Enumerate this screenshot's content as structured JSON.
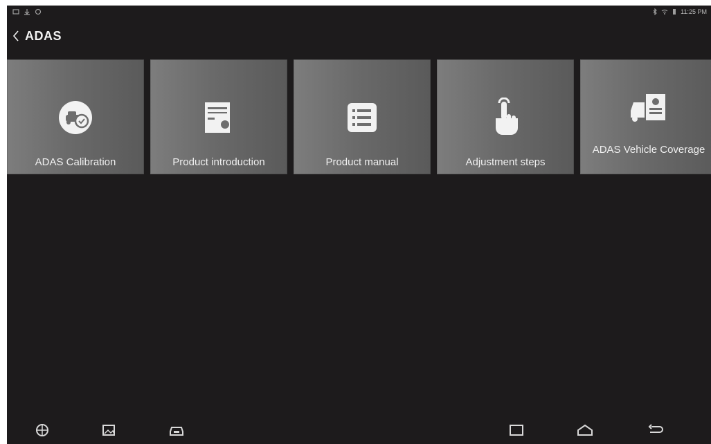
{
  "header": {
    "title": "ADAS"
  },
  "tiles": [
    {
      "label": "ADAS Calibration",
      "icon": "adas-calibration-icon"
    },
    {
      "label": "Product introduction",
      "icon": "product-introduction-icon"
    },
    {
      "label": "Product manual",
      "icon": "list-icon"
    },
    {
      "label": "Adjustment steps",
      "icon": "tap-hand-icon"
    },
    {
      "label": "ADAS Vehicle Coverage",
      "icon": "vehicle-coverage-icon"
    }
  ],
  "status": {
    "time": "11:25 PM"
  },
  "colors": {
    "background": "#1d1b1c",
    "tile": "#6e6e6e",
    "text": "#efefef"
  }
}
